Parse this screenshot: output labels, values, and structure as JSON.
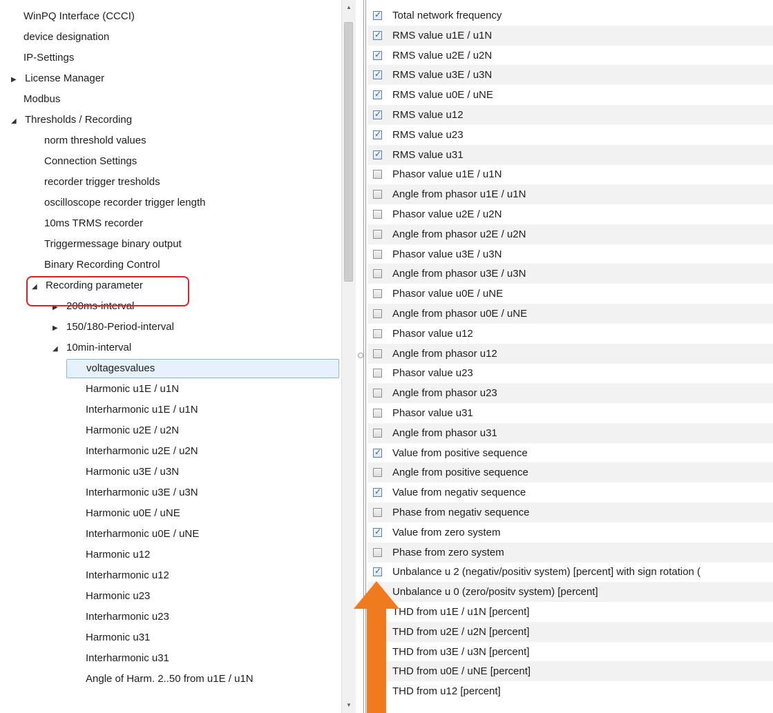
{
  "tree": {
    "items": [
      {
        "label": "WinPQ Interface (CCCI)",
        "arrow": "",
        "level": 0
      },
      {
        "label": "device designation",
        "arrow": "",
        "level": 0
      },
      {
        "label": "IP-Settings",
        "arrow": "",
        "level": 0
      },
      {
        "label": "License Manager",
        "arrow": "▶",
        "level": 0
      },
      {
        "label": "Modbus",
        "arrow": "",
        "level": 0
      },
      {
        "label": "Thresholds / Recording",
        "arrow": "◢",
        "level": 0
      },
      {
        "label": "norm threshold values",
        "arrow": "",
        "level": 1
      },
      {
        "label": "Connection Settings",
        "arrow": "",
        "level": 1
      },
      {
        "label": "recorder trigger tresholds",
        "arrow": "",
        "level": 1
      },
      {
        "label": "oscilloscope  recorder trigger  length",
        "arrow": "",
        "level": 1
      },
      {
        "label": "10ms TRMS recorder",
        "arrow": "",
        "level": 1
      },
      {
        "label": "Triggermessage binary output",
        "arrow": "",
        "level": 1
      },
      {
        "label": "Binary Recording Control",
        "arrow": "",
        "level": 1
      },
      {
        "label": "Recording parameter",
        "arrow": "◢",
        "level": 1
      },
      {
        "label": "200ms-interval",
        "arrow": "▶",
        "level": 2
      },
      {
        "label": "150/180-Period-interval",
        "arrow": "▶",
        "level": 2
      },
      {
        "label": "10min-interval",
        "arrow": "◢",
        "level": 2
      },
      {
        "label": "voltagesvalues",
        "arrow": "",
        "level": 3,
        "selected": true
      },
      {
        "label": "Harmonic u1E / u1N",
        "arrow": "",
        "level": 3
      },
      {
        "label": "Interharmonic u1E / u1N",
        "arrow": "",
        "level": 3
      },
      {
        "label": "Harmonic u2E / u2N",
        "arrow": "",
        "level": 3
      },
      {
        "label": "Interharmonic u2E / u2N",
        "arrow": "",
        "level": 3
      },
      {
        "label": "Harmonic u3E / u3N",
        "arrow": "",
        "level": 3
      },
      {
        "label": "Interharmonic u3E / u3N",
        "arrow": "",
        "level": 3
      },
      {
        "label": "Harmonic u0E / uNE",
        "arrow": "",
        "level": 3
      },
      {
        "label": "Interharmonic u0E / uNE",
        "arrow": "",
        "level": 3
      },
      {
        "label": "Harmonic u12",
        "arrow": "",
        "level": 3
      },
      {
        "label": "Interharmonic u12",
        "arrow": "",
        "level": 3
      },
      {
        "label": "Harmonic u23",
        "arrow": "",
        "level": 3
      },
      {
        "label": "Interharmonic u23",
        "arrow": "",
        "level": 3
      },
      {
        "label": "Harmonic u31",
        "arrow": "",
        "level": 3
      },
      {
        "label": "Interharmonic u31",
        "arrow": "",
        "level": 3
      },
      {
        "label": "Angle of Harm. 2..50  from u1E / u1N",
        "arrow": "",
        "level": 3
      }
    ]
  },
  "checklist": {
    "items": [
      {
        "label": "Total network frequency",
        "checked": true
      },
      {
        "label": "RMS value u1E / u1N",
        "checked": true
      },
      {
        "label": "RMS value u2E / u2N",
        "checked": true
      },
      {
        "label": "RMS value u3E / u3N",
        "checked": true
      },
      {
        "label": "RMS value u0E / uNE",
        "checked": true
      },
      {
        "label": "RMS value u12",
        "checked": true
      },
      {
        "label": "RMS value u23",
        "checked": true
      },
      {
        "label": "RMS value u31",
        "checked": true
      },
      {
        "label": "Phasor value u1E / u1N",
        "checked": false
      },
      {
        "label": "Angle from phasor u1E / u1N",
        "checked": false
      },
      {
        "label": "Phasor value u2E / u2N",
        "checked": false
      },
      {
        "label": "Angle from phasor u2E / u2N",
        "checked": false
      },
      {
        "label": "Phasor value u3E / u3N",
        "checked": false
      },
      {
        "label": "Angle from phasor u3E / u3N",
        "checked": false
      },
      {
        "label": "Phasor value u0E / uNE",
        "checked": false
      },
      {
        "label": "Angle from phasor u0E / uNE",
        "checked": false
      },
      {
        "label": "Phasor value u12",
        "checked": false
      },
      {
        "label": "Angle from phasor u12",
        "checked": false
      },
      {
        "label": "Phasor value u23",
        "checked": false
      },
      {
        "label": "Angle from phasor u23",
        "checked": false
      },
      {
        "label": "Phasor value u31",
        "checked": false
      },
      {
        "label": "Angle from phasor u31",
        "checked": false
      },
      {
        "label": "Value from positive sequence",
        "checked": true
      },
      {
        "label": "Angle from positive sequence",
        "checked": false
      },
      {
        "label": "Value from negativ sequence",
        "checked": true
      },
      {
        "label": "Phase from negativ sequence",
        "checked": false
      },
      {
        "label": "Value from zero system",
        "checked": true
      },
      {
        "label": "Phase from  zero system",
        "checked": false
      },
      {
        "label": "Unbalance u 2  (negativ/positiv system) [percent] with sign rotation (",
        "checked": true
      },
      {
        "label": "Unbalance u 0  (zero/positv system) [percent]",
        "checked": false
      },
      {
        "label": "THD from u1E / u1N [percent]",
        "checked": true
      },
      {
        "label": "THD from u2E / u2N [percent]",
        "checked": true
      },
      {
        "label": "THD from u3E / u3N [percent]",
        "checked": false
      },
      {
        "label": "THD from u0E / uNE [percent]",
        "checked": false
      },
      {
        "label": "THD from u12 [percent]",
        "checked": false
      }
    ]
  },
  "annotations": {
    "highlight_color": "#e02020",
    "arrow_color": "#f07a1e"
  }
}
